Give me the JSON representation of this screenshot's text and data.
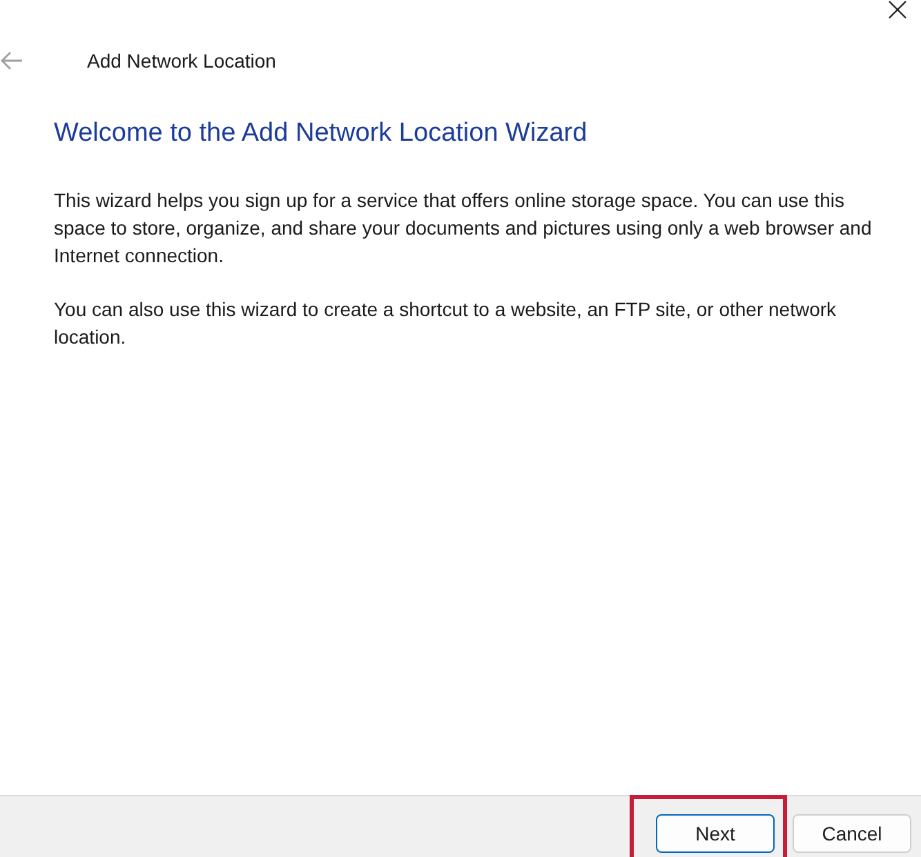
{
  "window": {
    "title": "Add Network Location",
    "back_disabled": true
  },
  "heading": "Welcome to the Add Network Location Wizard",
  "paragraphs": [
    "This wizard helps you sign up for a service that offers online storage space.  You can use this space to store, organize, and share your documents and pictures using only a web browser and Internet connection.",
    "You can also use this wizard to create a shortcut to a website, an FTP site, or other network location."
  ],
  "buttons": [
    {
      "label": "Next",
      "default": true,
      "highlighted": true
    },
    {
      "label": "Cancel",
      "default": false,
      "highlighted": false
    }
  ]
}
